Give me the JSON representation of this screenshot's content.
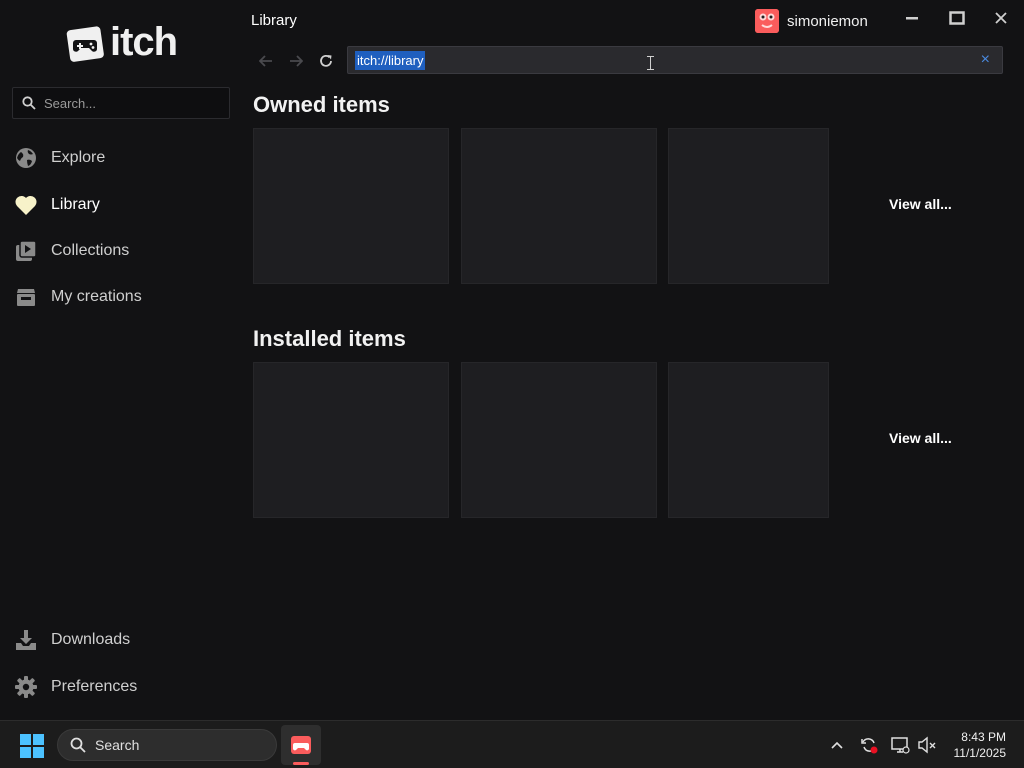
{
  "app": {
    "logo_text": "itch",
    "page_title": "Library",
    "user_name": "simoniemon",
    "accent_color": "#fa5c5c",
    "selection_color": "#1f5fbf"
  },
  "sidebar": {
    "search_placeholder": "Search...",
    "nav": [
      {
        "label": "Explore",
        "icon": "globe-icon"
      },
      {
        "label": "Library",
        "icon": "heart-icon"
      },
      {
        "label": "Collections",
        "icon": "collection-icon"
      },
      {
        "label": "My creations",
        "icon": "store-icon"
      }
    ],
    "bottom_nav": [
      {
        "label": "Downloads",
        "icon": "download-icon"
      },
      {
        "label": "Preferences",
        "icon": "gear-icon"
      }
    ]
  },
  "toolbar": {
    "address": "itch://library"
  },
  "main": {
    "sections": [
      {
        "title": "Owned items",
        "view_all": "View all..."
      },
      {
        "title": "Installed items",
        "view_all": "View all..."
      }
    ]
  },
  "taskbar": {
    "search_label": "Search",
    "time": "8:43 PM",
    "date": "11/1/2025"
  }
}
